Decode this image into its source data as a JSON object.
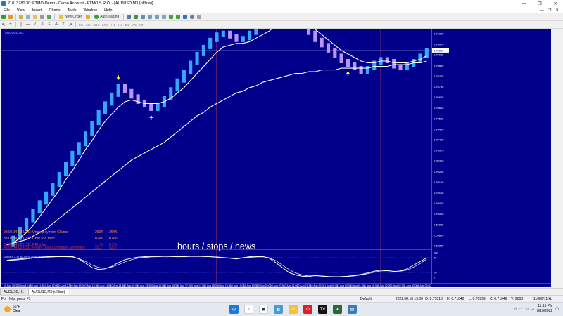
{
  "window": {
    "title": "21013780 30: FTMO-Demo - Demo Account - FTMO S.R.O. - [AUDUSD,M3 (offline)]",
    "controls": [
      "—",
      "❐",
      "✕"
    ]
  },
  "menu": {
    "items": [
      "File",
      "View",
      "Insert",
      "Charts",
      "Tools",
      "Window",
      "Help"
    ],
    "doc_controls": [
      "—",
      "❐",
      "✕"
    ]
  },
  "toolbar": {
    "new_order_label": "New Order",
    "autotrading_label": "AutoTrading",
    "timeframes": [
      "M1",
      "M5",
      "M15",
      "M30",
      "H1",
      "H4",
      "D1",
      "W1",
      "MN"
    ]
  },
  "chart": {
    "symbol_label": "AUDUSD,M3",
    "current_price_label": "0.70230",
    "annotation": "hours / stops / news",
    "oscillator_label": "Stoch(8,3,3) 80.4529 75.4625",
    "colors": {
      "background": "#00008b",
      "bull_bar": "#38b0ff",
      "bear_bar": "#c49cff",
      "ma": "#ffffff",
      "arrow": "#ffff00",
      "session_line": "#c84050",
      "grid_dots": "#6a6ac8"
    },
    "news": [
      {
        "event": "9d 05 14:02   USD: Unemployment Claims",
        "actual": "260K",
        "forecast": "264K"
      },
      {
        "event": "8d 05 14:32   USD: Core PPI m/m",
        "actual": "0.4%",
        "forecast": "0.4%"
      },
      {
        "event": "5d 04 14:02   USD: PPI m/m",
        "actual": "1.1%",
        "forecast": "0.2%"
      },
      {
        "event": "4d 05 14:02   USD: Prelim UoM Consumer Sentiment",
        "actual": "51.1",
        "forecast": "52.5"
      }
    ]
  },
  "chart_data": {
    "type": "line",
    "title": "AUDUSD,M3",
    "y_ticks": [
      "0.71035",
      "0.70975",
      "0.70915",
      "0.70855",
      "0.70795",
      "0.70735",
      "0.70675",
      "0.70615",
      "0.70555",
      "0.70495",
      "0.70435",
      "0.70375",
      "0.70315",
      "0.70255",
      "0.70195",
      "0.70135",
      "0.70075",
      "0.70015",
      "0.69955",
      "0.69895",
      "0.69835"
    ],
    "osc_ticks": [
      "100",
      "80",
      "20",
      "0"
    ],
    "x_ticks": [
      "10 Aug 2022",
      "10 Aug 10:45",
      "10 Aug 11:30",
      "10 Aug 12:00",
      "10 Aug 12:30",
      "10 Aug 13:00",
      "10 Aug 13:30",
      "10 Aug 14:00",
      "10 Aug 14:30",
      "10 Aug 15:00",
      "10 Aug 15:30",
      "10 Aug 16:00",
      "10 Aug 16:30",
      "10 Aug 17:00",
      "10 Aug 17:30",
      "10 Aug 18:00",
      "10 Aug 18:30",
      "10 Aug 19:00",
      "10 Aug 19:30",
      "10 Aug 20:00",
      "10 Aug 20:30",
      "10 Aug 21:00",
      "10 Aug 21:30",
      "10 Aug 22:00",
      "11 Aug 00:00",
      "11 Aug 00:30",
      "11 Aug 01:00",
      "11 Aug 01:30",
      "11 Aug 02:00",
      "11 Aug 02:30",
      "11 Aug 03:00",
      "11 Aug 03:30"
    ],
    "closes": [
      0.6984,
      0.6988,
      0.6993,
      0.6998,
      0.7003,
      0.7008,
      0.7013,
      0.7018,
      0.7024,
      0.703,
      0.7036,
      0.7041,
      0.7047,
      0.7053,
      0.7059,
      0.7064,
      0.7069,
      0.7074,
      0.7071,
      0.7068,
      0.7065,
      0.7063,
      0.7061,
      0.7063,
      0.7067,
      0.7072,
      0.7077,
      0.7082,
      0.7087,
      0.7092,
      0.7096,
      0.71,
      0.7103,
      0.7104,
      0.7102,
      0.71,
      0.7101,
      0.7104,
      0.7107,
      0.711,
      0.7113,
      0.7116,
      0.7117,
      0.7115,
      0.7112,
      0.7108,
      0.7104,
      0.71,
      0.7097,
      0.7094,
      0.7091,
      0.7088,
      0.7086,
      0.7084,
      0.7082,
      0.7084,
      0.7087,
      0.7089,
      0.7088,
      0.7085,
      0.7084,
      0.7086,
      0.7088,
      0.7091,
      0.7094
    ],
    "fast_ma": [
      0.6984,
      0.6985,
      0.6988,
      0.6991,
      0.6995,
      0.7,
      0.7005,
      0.701,
      0.7015,
      0.7021,
      0.7026,
      0.7032,
      0.7038,
      0.7043,
      0.7049,
      0.7054,
      0.7058,
      0.7062,
      0.7065,
      0.7066,
      0.7065,
      0.7064,
      0.7064,
      0.7064,
      0.7065,
      0.7067,
      0.707,
      0.7073,
      0.7077,
      0.7081,
      0.7085,
      0.7089,
      0.7093,
      0.7096,
      0.7097,
      0.7098,
      0.7098,
      0.7099,
      0.7101,
      0.7103,
      0.7105,
      0.7108,
      0.711,
      0.7111,
      0.7111,
      0.711,
      0.7108,
      0.7106,
      0.7103,
      0.71,
      0.7097,
      0.7094,
      0.7092,
      0.709,
      0.7088,
      0.7087,
      0.7087,
      0.7088,
      0.7088,
      0.7087,
      0.7087,
      0.7087,
      0.7088,
      0.7089,
      0.7091
    ],
    "slow_ma": [
      0.6984,
      0.6985,
      0.6986,
      0.6987,
      0.6989,
      0.6991,
      0.6993,
      0.6996,
      0.6999,
      0.7002,
      0.7005,
      0.7008,
      0.7011,
      0.7014,
      0.7017,
      0.702,
      0.7023,
      0.7026,
      0.7029,
      0.7032,
      0.7034,
      0.7036,
      0.7038,
      0.704,
      0.7042,
      0.7045,
      0.7048,
      0.7051,
      0.7054,
      0.7057,
      0.7059,
      0.7062,
      0.7064,
      0.7066,
      0.7068,
      0.707,
      0.7071,
      0.7073,
      0.7074,
      0.7076,
      0.7077,
      0.7078,
      0.7079,
      0.708,
      0.7081,
      0.7081,
      0.7082,
      0.7082,
      0.7083,
      0.7083,
      0.7083,
      0.7084,
      0.7084,
      0.7084,
      0.7084,
      0.7084,
      0.7085,
      0.7085,
      0.7085,
      0.7086,
      0.7086,
      0.7086,
      0.7087,
      0.7087,
      0.7088
    ],
    "osc_main": [
      70,
      72,
      75,
      78,
      80,
      82,
      84,
      85,
      85,
      86,
      85,
      75,
      58,
      40,
      32,
      35,
      45,
      60,
      72,
      78,
      82,
      84,
      86,
      86,
      86,
      85,
      84,
      85,
      86,
      86,
      85,
      84,
      82,
      80,
      78,
      75,
      80,
      84,
      86,
      85,
      78,
      60,
      40,
      20,
      10,
      5,
      3,
      8,
      5,
      3,
      2,
      3,
      5,
      8,
      12,
      18,
      25,
      30,
      28,
      24,
      26,
      35,
      50,
      65,
      80
    ],
    "osc_signal": [
      68,
      70,
      72,
      75,
      78,
      80,
      82,
      83,
      84,
      84,
      83,
      77,
      65,
      50,
      40,
      38,
      42,
      52,
      63,
      72,
      78,
      81,
      83,
      84,
      85,
      85,
      84,
      84,
      85,
      85,
      85,
      84,
      83,
      81,
      79,
      77,
      78,
      81,
      83,
      84,
      80,
      68,
      50,
      32,
      18,
      10,
      6,
      7,
      6,
      4,
      3,
      3,
      4,
      6,
      10,
      15,
      21,
      26,
      27,
      25,
      25,
      30,
      42,
      56,
      75
    ],
    "down_arrows_at": [
      17,
      44
    ],
    "up_arrows_at": [
      22,
      52
    ],
    "session_lines_at": [
      32,
      57
    ]
  },
  "tabs": [
    "AUDUSD,H1",
    "AUDUSD,M3 (offline)"
  ],
  "status": {
    "help": "For Help, press F1",
    "profile": "Default",
    "datetime": "2022.08.10 19:00",
    "open": "O: 0.71013",
    "high": "H: 0.71046",
    "low": "L: 0.70999",
    "close": "C: 0.71046",
    "volume": "V: 2603",
    "traffic": "11080/11 kb"
  },
  "taskbar": {
    "temp": "66°F",
    "condition": "Clear",
    "time": "11:15 PM",
    "date": "8/10/2022"
  }
}
